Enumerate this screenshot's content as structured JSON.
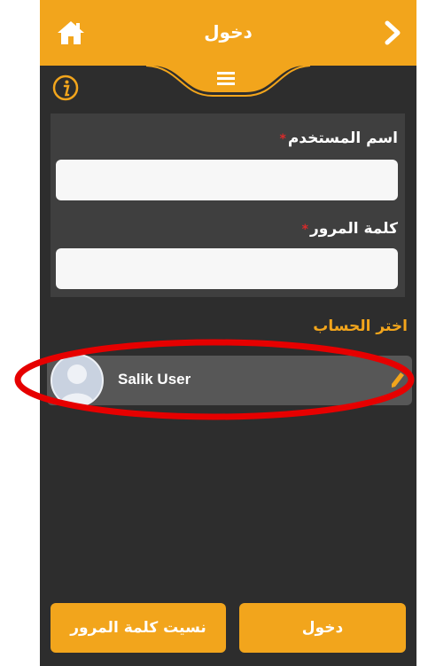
{
  "header": {
    "title": "دخول",
    "home_icon": "home-icon",
    "back_icon": "chevron-right-icon",
    "menu_icon": "hamburger-menu-icon",
    "info_icon": "info-icon"
  },
  "form": {
    "username": {
      "label": "اسم المستخدم",
      "required_mark": "*",
      "value": ""
    },
    "password": {
      "label": "كلمة المرور",
      "required_mark": "*",
      "value": ""
    }
  },
  "accounts": {
    "title": "اختر الحساب",
    "items": [
      {
        "name": "Salik User",
        "avatar_icon": "user-avatar-icon",
        "edit_icon": "pencil-icon"
      }
    ]
  },
  "buttons": {
    "forgot_password": "نسيت كلمة المرور",
    "login": "دخول"
  },
  "colors": {
    "accent": "#f2a51c",
    "background": "#2d2d2d",
    "panel": "#3f3f3f",
    "account_row": "#575757",
    "required": "#d92a2a",
    "annotation": "#e60000"
  }
}
